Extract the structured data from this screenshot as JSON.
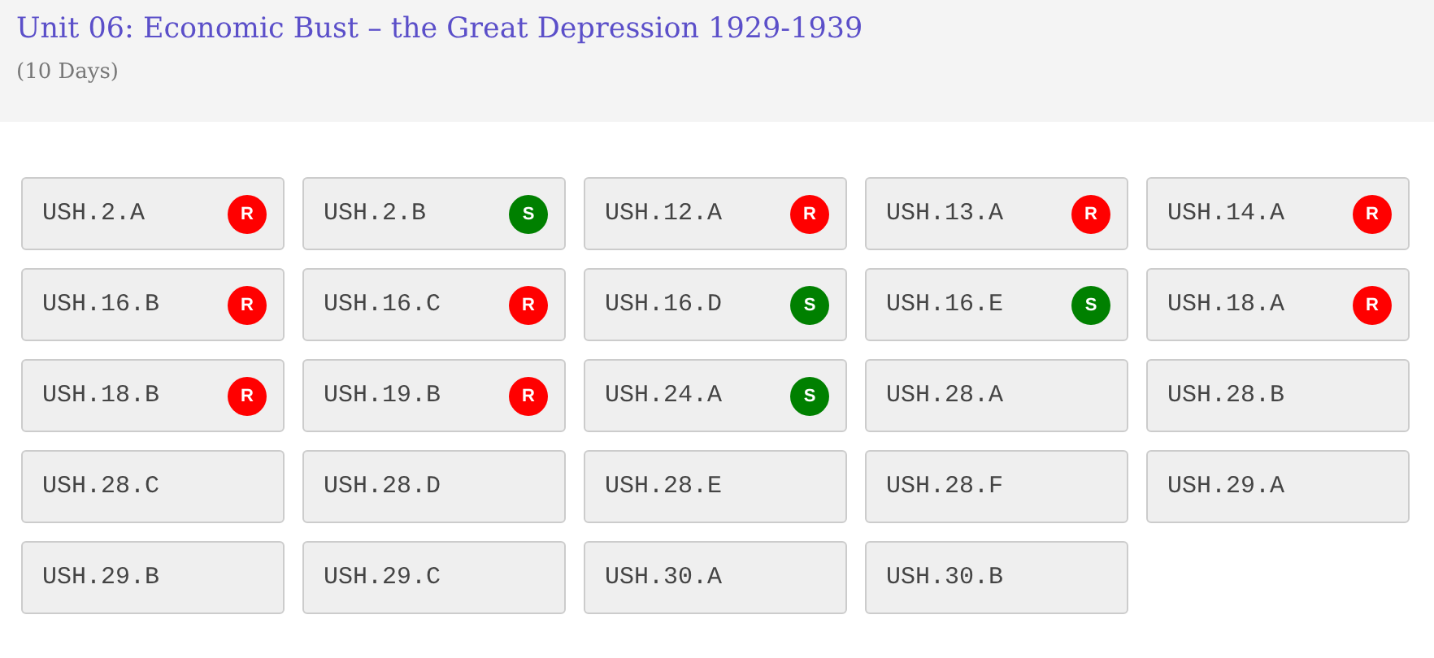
{
  "header": {
    "title": "Unit 06: Economic Bust – the Great Depression 1929-1939",
    "subtitle": "(10 Days)"
  },
  "standards": [
    {
      "code": "USH.2.A",
      "badge": {
        "label": "R",
        "color": "#ff0000"
      }
    },
    {
      "code": "USH.2.B",
      "badge": {
        "label": "S",
        "color": "#008000"
      }
    },
    {
      "code": "USH.12.A",
      "badge": {
        "label": "R",
        "color": "#ff0000"
      }
    },
    {
      "code": "USH.13.A",
      "badge": {
        "label": "R",
        "color": "#ff0000"
      }
    },
    {
      "code": "USH.14.A",
      "badge": {
        "label": "R",
        "color": "#ff0000"
      }
    },
    {
      "code": "USH.16.B",
      "badge": {
        "label": "R",
        "color": "#ff0000"
      }
    },
    {
      "code": "USH.16.C",
      "badge": {
        "label": "R",
        "color": "#ff0000"
      }
    },
    {
      "code": "USH.16.D",
      "badge": {
        "label": "S",
        "color": "#008000"
      }
    },
    {
      "code": "USH.16.E",
      "badge": {
        "label": "S",
        "color": "#008000"
      }
    },
    {
      "code": "USH.18.A",
      "badge": {
        "label": "R",
        "color": "#ff0000"
      }
    },
    {
      "code": "USH.18.B",
      "badge": {
        "label": "R",
        "color": "#ff0000"
      }
    },
    {
      "code": "USH.19.B",
      "badge": {
        "label": "R",
        "color": "#ff0000"
      }
    },
    {
      "code": "USH.24.A",
      "badge": {
        "label": "S",
        "color": "#008000"
      }
    },
    {
      "code": "USH.28.A"
    },
    {
      "code": "USH.28.B"
    },
    {
      "code": "USH.28.C"
    },
    {
      "code": "USH.28.D"
    },
    {
      "code": "USH.28.E"
    },
    {
      "code": "USH.28.F"
    },
    {
      "code": "USH.29.A"
    },
    {
      "code": "USH.29.B"
    },
    {
      "code": "USH.29.C"
    },
    {
      "code": "USH.30.A"
    },
    {
      "code": "USH.30.B"
    }
  ]
}
